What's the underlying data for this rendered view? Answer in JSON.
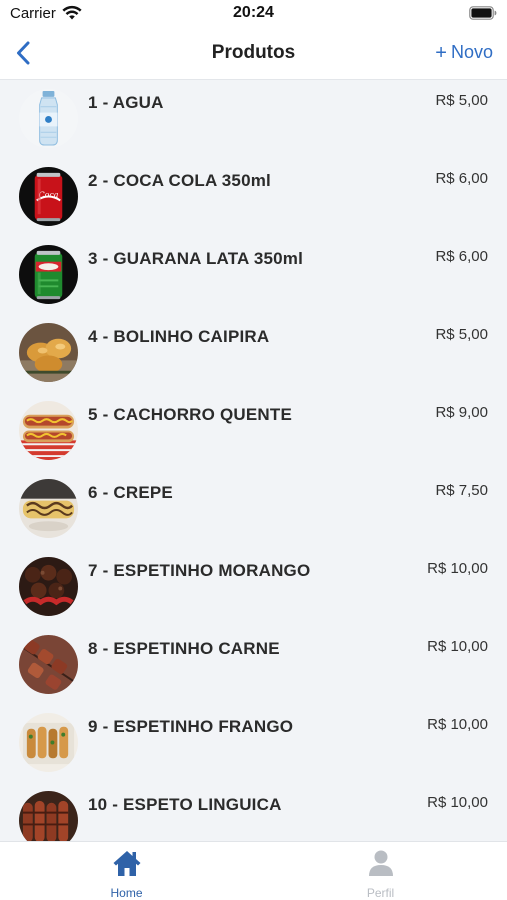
{
  "status_bar": {
    "carrier": "Carrier",
    "time": "20:24",
    "wifi_icon": "wifi-icon",
    "battery_icon": "battery-full-icon"
  },
  "nav": {
    "title": "Produtos",
    "back_icon": "chevron-left-icon",
    "new_button_icon": "+",
    "new_button_label": "Novo",
    "accent_color": "#2f6dc4"
  },
  "products": [
    {
      "label": "1 - AGUA",
      "price": "R$ 5,00",
      "thumbnail": "water-bottle"
    },
    {
      "label": "2 - COCA COLA 350ml",
      "price": "R$ 6,00",
      "thumbnail": "cola-can"
    },
    {
      "label": "3 - GUARANA LATA 350ml",
      "price": "R$ 6,00",
      "thumbnail": "guarana-can"
    },
    {
      "label": "4 - BOLINHO CAIPIRA",
      "price": "R$ 5,00",
      "thumbnail": "fried-dumplings"
    },
    {
      "label": "5 - CACHORRO QUENTE",
      "price": "R$ 9,00",
      "thumbnail": "hot-dog"
    },
    {
      "label": "6 - CREPE",
      "price": "R$ 7,50",
      "thumbnail": "crepe"
    },
    {
      "label": "7 - ESPETINHO MORANGO",
      "price": "R$ 10,00",
      "thumbnail": "chocolate-strawberry-skewer"
    },
    {
      "label": "8 - ESPETINHO CARNE",
      "price": "R$ 10,00",
      "thumbnail": "meat-skewer"
    },
    {
      "label": "9 - ESPETINHO FRANGO",
      "price": "R$ 10,00",
      "thumbnail": "chicken-skewer"
    },
    {
      "label": "10 - ESPETO LINGUICA",
      "price": "R$ 10,00",
      "thumbnail": "sausage-skewer"
    }
  ],
  "tabs": [
    {
      "label": "Home",
      "icon": "home-icon",
      "active": true,
      "color": "#2f62a8"
    },
    {
      "label": "Perfil",
      "icon": "person-icon",
      "active": false,
      "color": "#b9bdc3"
    }
  ]
}
